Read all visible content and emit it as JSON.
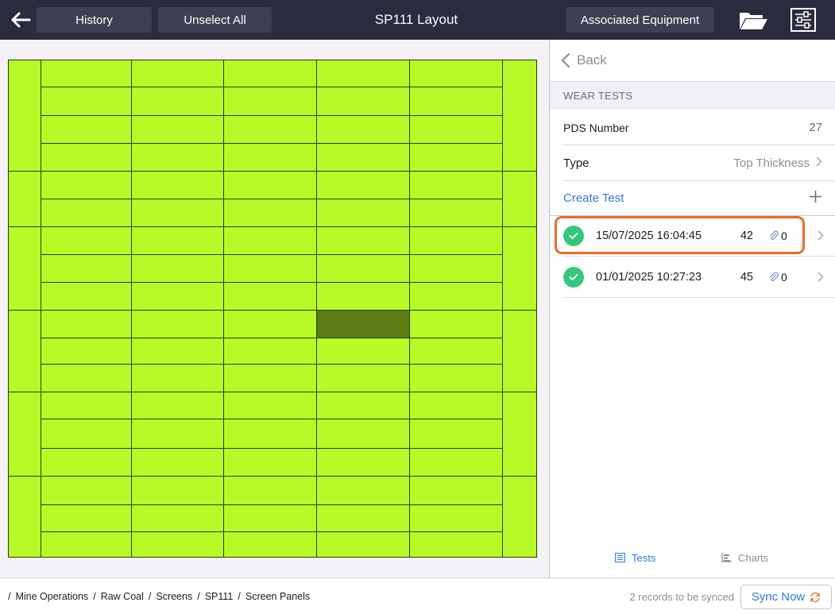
{
  "header": {
    "title": "SP111 Layout",
    "history_label": "History",
    "unselect_label": "Unselect All",
    "associated_label": "Associated Equipment"
  },
  "layout_panel": {
    "panel_color": "#b8fa26",
    "selected_color": "#5a7c10",
    "columns": 6,
    "selected_panel": "row 11, column 5"
  },
  "side_panel": {
    "back_label": "Back",
    "section_title": "WEAR TESTS",
    "pds": {
      "label": "PDS Number",
      "value": "27"
    },
    "type": {
      "label": "Type",
      "value": "Top Thickness"
    },
    "create_label": "Create Test",
    "tests": [
      {
        "date": "15/07/2025 16:04:45",
        "thickness": "42",
        "attachments": "0",
        "highlighted": true
      },
      {
        "date": "01/01/2025 10:27:23",
        "thickness": "45",
        "attachments": "0",
        "highlighted": false
      }
    ],
    "tabs": {
      "tests": "Tests",
      "charts": "Charts"
    },
    "colors": {
      "accent": "#2f7bde",
      "success": "#35c87a",
      "highlight": "#f0692a"
    }
  },
  "footer": {
    "breadcrumb": [
      "Mine Operations",
      "Raw Coal",
      "Screens",
      "SP111",
      "Screen Panels"
    ],
    "sync_status": "2 records to be synced",
    "sync_label": "Sync Now"
  },
  "icons": [
    "back-arrow-icon",
    "folder-icon",
    "settings-sliders-icon",
    "chevron-left-icon",
    "chevron-right-icon",
    "plus-icon",
    "checkmark-icon",
    "paperclip-icon",
    "list-icon",
    "chart-icon",
    "sync-icon"
  ]
}
